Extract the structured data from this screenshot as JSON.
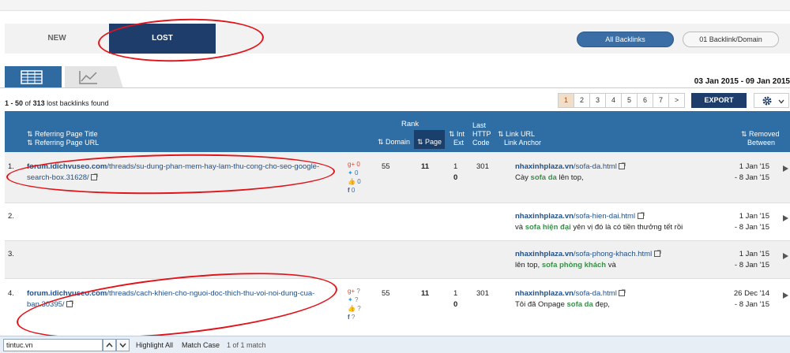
{
  "tabs": {
    "new": "NEW",
    "lost": "LOST"
  },
  "filters": {
    "all": "All Backlinks",
    "one_per_domain": "01 Backlink/Domain"
  },
  "date_range": "03 Jan 2015 - 09 Jan 2015",
  "result_count": {
    "range": "1 - 50",
    "of": "of",
    "total": "313",
    "suffix": "lost backlinks found"
  },
  "pagination": {
    "pages": [
      "1",
      "2",
      "3",
      "4",
      "5",
      "6",
      "7",
      ">"
    ],
    "active": "1"
  },
  "export_label": "EXPORT",
  "columns": {
    "ref_title": "Referring Page Title",
    "ref_url": "Referring Page URL",
    "rank": "Rank",
    "domain": "Domain",
    "page": "Page",
    "int": "Int",
    "ext": "Ext",
    "http_last": "Last",
    "http_http": "HTTP",
    "http_code": "Code",
    "link_url": "Link URL",
    "link_anchor": "Link Anchor",
    "removed": "Removed",
    "between": "Between"
  },
  "rows": [
    {
      "num": "1.",
      "ref_host": "forum.idichvuseo.com",
      "ref_path": "/threads/su-dung-phan-mem-hay-lam-thu-cong-cho-seo-google-search-box.31628/",
      "social": {
        "gplus": "0",
        "twitter": "0",
        "like": "0",
        "facebook": "0"
      },
      "domain_rank": "55",
      "page_rank": "11",
      "int": "1",
      "ext": "0",
      "http": "301",
      "link_host": "nhaxinhplaza.vn",
      "link_path": "/sofa-da.html",
      "anchor_pre": "Cày ",
      "anchor_hi": "sofa da",
      "anchor_post": " lên top,",
      "removed_from": "1 Jan '15",
      "removed_to": "- 8 Jan '15"
    },
    {
      "num": "2.",
      "link_host": "nhaxinhplaza.vn",
      "link_path": "/sofa-hien-dai.html",
      "anchor_pre": "và ",
      "anchor_hi": "sofa hiện đại",
      "anchor_post": " yên vị đó là có tiền thưởng tết rồi",
      "removed_from": "1 Jan '15",
      "removed_to": "- 8 Jan '15"
    },
    {
      "num": "3.",
      "link_host": "nhaxinhplaza.vn",
      "link_path": "/sofa-phong-khach.html",
      "anchor_pre": "lên top, ",
      "anchor_hi": "sofa phòng khách",
      "anchor_post": " và",
      "removed_from": "1 Jan '15",
      "removed_to": "- 8 Jan '15"
    },
    {
      "num": "4.",
      "ref_host": "forum.idichvuseo.com",
      "ref_path": "/threads/cach-khien-cho-nguoi-doc-thich-thu-voi-noi-dung-cua-ban.30395/",
      "social": {
        "gplus": "?",
        "twitter": "?",
        "like": "?",
        "facebook": "?"
      },
      "domain_rank": "55",
      "page_rank": "11",
      "int": "1",
      "ext": "0",
      "http": "301",
      "link_host": "nhaxinhplaza.vn",
      "link_path": "/sofa-da.html",
      "anchor_pre": "Tôi đã Onpage ",
      "anchor_hi": "sofa da",
      "anchor_post": " đẹp,",
      "removed_from": "26 Dec '14",
      "removed_to": "- 8 Jan '15"
    }
  ],
  "findbar": {
    "query": "tintuc.vn",
    "highlight_all": "Highlight All",
    "match_case": "Match Case",
    "result": "1 of 1 match"
  },
  "colors": {
    "accent": "#1f3d6a",
    "header": "#2f6ea5",
    "annotation": "#e0141a",
    "anchor_highlight": "#3a8f4a"
  }
}
